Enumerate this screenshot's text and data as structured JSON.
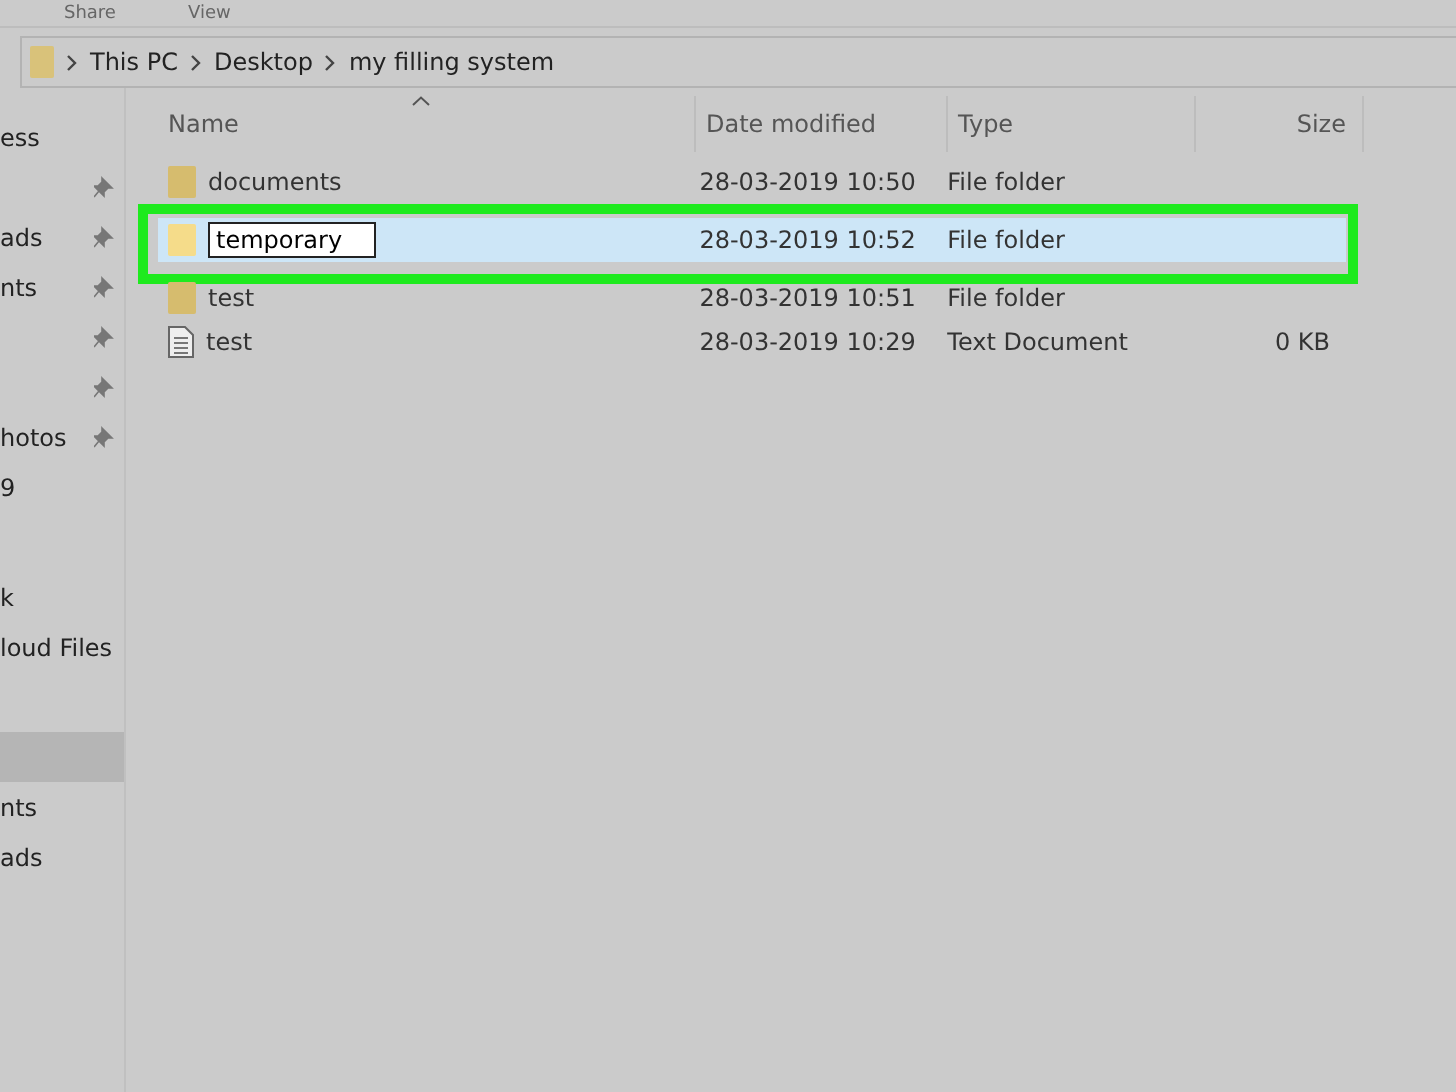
{
  "ribbon_tabs": [
    {
      "label": "Share"
    },
    {
      "label": "View"
    }
  ],
  "breadcrumb": [
    "This PC",
    "Desktop",
    "my filling system"
  ],
  "sidebar": {
    "groups": [
      [
        {
          "label": "ess",
          "pinned": false,
          "selected": false
        },
        {
          "pinned": true,
          "selected": false
        },
        {
          "label": "ads",
          "pinned": true,
          "selected": false
        },
        {
          "label": "nts",
          "pinned": true,
          "selected": false
        },
        {
          "pinned": true,
          "selected": false
        },
        {
          "pinned": true,
          "selected": false
        },
        {
          "label": "hotos",
          "pinned": true,
          "selected": false
        },
        {
          "label": "9",
          "pinned": false,
          "selected": false
        }
      ],
      [
        {
          "label": "k",
          "pinned": false,
          "selected": false
        },
        {
          "label": "loud Files",
          "pinned": false,
          "selected": false
        }
      ],
      [
        {
          "pinned": false,
          "selected": true
        },
        {
          "label": "nts",
          "pinned": false,
          "selected": false
        },
        {
          "label": "ads",
          "pinned": false,
          "selected": false
        }
      ]
    ]
  },
  "table": {
    "columns": [
      "Name",
      "Date modified",
      "Type",
      "Size"
    ],
    "rows": [
      {
        "kind": "folder",
        "name": "documents",
        "date": "28-03-2019 10:50",
        "type": "File folder",
        "selected": false,
        "renaming": false
      },
      {
        "kind": "folder",
        "name": "temporary",
        "date": "28-03-2019 10:52",
        "type": "File folder",
        "selected": true,
        "renaming": true
      },
      {
        "kind": "folder",
        "name": "test",
        "date": "28-03-2019 10:51",
        "type": "File folder",
        "selected": false,
        "renaming": false
      },
      {
        "kind": "text",
        "name": "test",
        "date": "28-03-2019 10:29",
        "type": "Text Document",
        "size": "0 KB",
        "selected": false,
        "renaming": false
      }
    ]
  }
}
